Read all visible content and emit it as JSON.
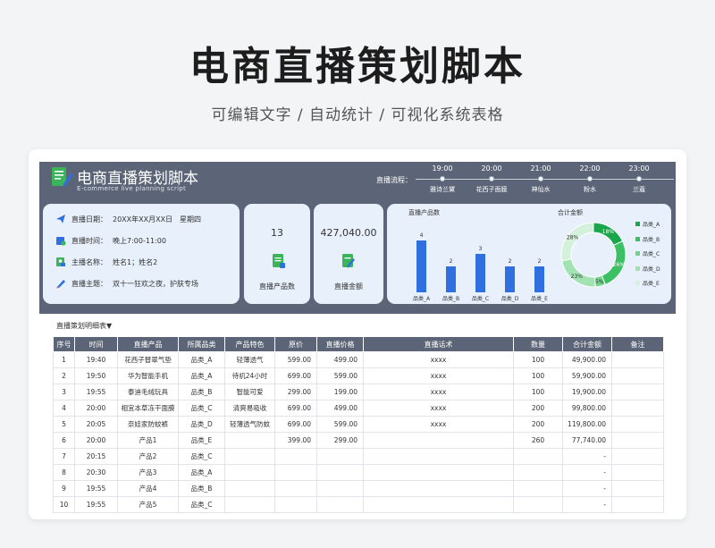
{
  "page": {
    "title": "电商直播策划脚本",
    "subtitle": "可编辑文字 / 自动统计 / 可视化系统表格"
  },
  "sheet": {
    "title": "电商直播策划脚本",
    "subtitle": "E-commerce live planning script",
    "flow_label": "直播流程：",
    "flow": [
      {
        "time": "19:00",
        "name": "雅诗兰黛"
      },
      {
        "time": "20:00",
        "name": "花西子面膜"
      },
      {
        "time": "21:00",
        "name": "神仙水"
      },
      {
        "time": "22:00",
        "name": "粉水"
      },
      {
        "time": "23:00",
        "name": "兰蔻"
      }
    ]
  },
  "info": {
    "rows": [
      {
        "label": "直播日期：",
        "value": "20XX年XX月XX日　星期四",
        "icon": "paper-plane-icon"
      },
      {
        "label": "直播时间：",
        "value": "晚上7:00-11:00",
        "icon": "calendar-clock-icon"
      },
      {
        "label": "主播名称：",
        "value": "姓名1；姓名2",
        "icon": "user-card-icon"
      },
      {
        "label": "直播主题：",
        "value": "双十一狂欢之夜，护肤专场",
        "icon": "pen-icon"
      }
    ]
  },
  "stats": {
    "product_count": {
      "value": "13",
      "label": "直播产品数",
      "icon": "document-icon"
    },
    "total_amount": {
      "value": "427,040.00",
      "label": "直播金额",
      "icon": "edit-document-icon"
    }
  },
  "colors": {
    "header_bg": "#5c6577",
    "panel_bg": "#e8f0fb",
    "bar": "#2f6fe0",
    "donut": [
      "#1aa64a",
      "#3cc064",
      "#6fd48a",
      "#a3e3b3",
      "#d4f1db"
    ]
  },
  "chart_data": [
    {
      "type": "bar",
      "title": "直播产品数",
      "categories": [
        "品类_A",
        "品类_B",
        "品类_C",
        "品类_D",
        "品类_E"
      ],
      "values": [
        4,
        2,
        3,
        2,
        2
      ],
      "ylim": [
        0,
        4
      ]
    },
    {
      "type": "pie",
      "title": "合计金额",
      "categories": [
        "品类_A",
        "品类_B",
        "品类_C",
        "品类_D",
        "品类_E"
      ],
      "values": [
        18,
        26,
        5,
        23,
        28
      ],
      "labels": [
        "18%",
        "26%",
        "5%",
        "23%",
        "28%"
      ],
      "legend": "right"
    }
  ],
  "table": {
    "title": "直播策划明细表▼",
    "headers": [
      "序号",
      "时间",
      "直播产品",
      "所属品类",
      "产品特色",
      "原价",
      "直播价格",
      "直播话术",
      "数量",
      "合计金额",
      "备注"
    ],
    "rows": [
      [
        "1",
        "19:40",
        "花西子替翠气垫",
        "品类_A",
        "轻薄透气",
        "599.00",
        "499.00",
        "xxxx",
        "100",
        "49,900.00",
        ""
      ],
      [
        "2",
        "19:50",
        "华为智能手机",
        "品类_A",
        "待机24小时",
        "699.00",
        "599.00",
        "xxxx",
        "100",
        "59,900.00",
        ""
      ],
      [
        "3",
        "19:55",
        "泰迪毛绒玩具",
        "品类_B",
        "智能可爱",
        "299.00",
        "199.00",
        "xxxx",
        "100",
        "19,900.00",
        ""
      ],
      [
        "4",
        "20:00",
        "相宜本草冻干面膜",
        "品类_C",
        "清爽易吸收",
        "699.00",
        "499.00",
        "xxxx",
        "200",
        "99,800.00",
        ""
      ],
      [
        "5",
        "20:05",
        "奈娃家防蚊裤",
        "品类_D",
        "轻薄透气防蚊",
        "699.00",
        "599.00",
        "xxxx",
        "200",
        "119,800.00",
        ""
      ],
      [
        "6",
        "20:00",
        "产品1",
        "品类_E",
        "",
        "399.00",
        "299.00",
        "",
        "260",
        "77,740.00",
        ""
      ],
      [
        "7",
        "20:15",
        "产品2",
        "品类_C",
        "",
        "",
        "",
        "",
        "",
        "-",
        ""
      ],
      [
        "8",
        "20:30",
        "产品3",
        "品类_A",
        "",
        "",
        "",
        "",
        "",
        "-",
        ""
      ],
      [
        "9",
        "19:55",
        "产品4",
        "品类_B",
        "",
        "",
        "",
        "",
        "",
        "-",
        ""
      ],
      [
        "10",
        "19:55",
        "产品5",
        "品类_C",
        "",
        "",
        "",
        "",
        "",
        "-",
        ""
      ]
    ]
  }
}
